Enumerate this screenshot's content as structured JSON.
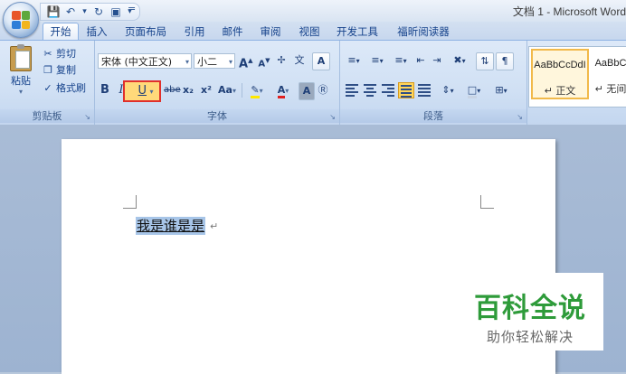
{
  "window": {
    "title": "文档 1 - Microsoft Word"
  },
  "qat": {
    "customize": "="
  },
  "tabs": [
    "开始",
    "插入",
    "页面布局",
    "引用",
    "邮件",
    "审阅",
    "视图",
    "开发工具",
    "福昕阅读器"
  ],
  "clipboard": {
    "label": "剪贴板",
    "paste": "粘贴",
    "cut": "剪切",
    "copy": "复制",
    "format_painter": "格式刷"
  },
  "font": {
    "label": "字体",
    "font_name": "宋体 (中文正文)",
    "font_size": "小二",
    "bold": "B",
    "italic": "I",
    "underline": "U",
    "strikethrough": "abe",
    "subscript": "x₂",
    "superscript": "x²",
    "change_case": "Aa",
    "grow": "A",
    "shrink": "A",
    "clear_format": "A",
    "phonetic": "A",
    "highlight_text": "A"
  },
  "paragraph": {
    "label": "段落"
  },
  "styles": {
    "items": [
      {
        "sample": "AaBbCcDdI",
        "name": "↵ 正文",
        "selected": true
      },
      {
        "sample": "AaBbC",
        "name": "↵ 无间",
        "selected": false
      }
    ]
  },
  "document": {
    "text": "我是谁是是",
    "paragraph_mark": "↵"
  },
  "watermark": {
    "main": "百科全说",
    "sub": "助你轻松解决",
    "color": "#2e9b3a"
  },
  "colors": {
    "selected_button_border": "#e0302c",
    "highlight": "#ffd97a",
    "selection": "#a7c5e8"
  }
}
